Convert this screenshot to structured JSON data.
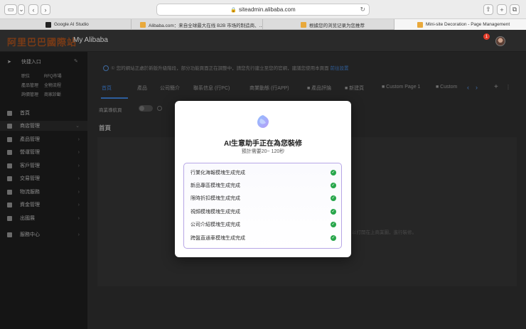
{
  "browser": {
    "url": "siteadmin.alibaba.com",
    "tabs": [
      {
        "title": "Google AI Studio",
        "favicon": "google-ai-studio-favicon"
      },
      {
        "title": "Alibaba.com：来自全球最大在线 B2B 市场的制造商、...",
        "favicon": "alibaba-favicon"
      },
      {
        "title": "根據您的浏览记录为您推荐",
        "favicon": "alibaba-favicon"
      },
      {
        "title": "Mini-site Decoration - Page Management",
        "favicon": "alibaba-favicon",
        "active": true
      }
    ]
  },
  "header": {
    "logo_text": "阿里巴巴國際站",
    "title": "My Alibaba",
    "notification_count": "1"
  },
  "sidebar": {
    "quick_entry": "快捷入口",
    "quick_links_row1": [
      "职位",
      "RFQ市場"
    ],
    "quick_links_row2": [
      "產品管理",
      "全物流程"
    ],
    "quick_links_row3": [
      "詢價管理",
      "商家診斷"
    ],
    "items": [
      {
        "label": "首頁",
        "icon": "home-icon"
      },
      {
        "label": "商店管理",
        "icon": "store-icon",
        "active": true
      },
      {
        "label": "產品管理",
        "icon": "product-icon"
      },
      {
        "label": "營運管理",
        "icon": "operation-icon"
      },
      {
        "label": "客戶管理",
        "icon": "customer-icon"
      },
      {
        "label": "交易管理",
        "icon": "trade-icon"
      },
      {
        "label": "物流服務",
        "icon": "logistics-icon"
      },
      {
        "label": "資金管理",
        "icon": "finance-icon"
      },
      {
        "label": "出國展",
        "icon": "exhibition-icon"
      },
      {
        "label": "服務中心",
        "icon": "service-icon"
      }
    ]
  },
  "main": {
    "notice_text": "① 您的網站正處於新版升級階段，部分功能頁面正在調整中，請您先行建立至您的官網，建議您使用本頁面",
    "notice_link": "前往設置",
    "tabs": [
      "首頁",
      "產品",
      "公司簡介",
      "聯系信息 (行PC)",
      "商業動態 (行APP)",
      "■ 產品評論",
      "■ 新建頁",
      "■ Custom Page 1",
      "■ Custom"
    ],
    "switch_label": "商業導航頁",
    "page_label": "首頁",
    "panel_text": "以打開在上商業圖，進行裝修。"
  },
  "modal": {
    "title": "AI生意助手正在為您裝修",
    "subtitle": "預計需要20~ 120秒",
    "tasks": [
      "行業化海報模塊生成完成",
      "新品專區模塊生成完成",
      "限時折扣模塊生成完成",
      "視頻模塊模塊生成完成",
      "公司介紹模塊生成完成",
      "跨盤直通車模塊生成完成"
    ]
  },
  "colors": {
    "accent": "#2d5e9d",
    "success": "#27a64a",
    "task_border": "#b7a6e6"
  }
}
